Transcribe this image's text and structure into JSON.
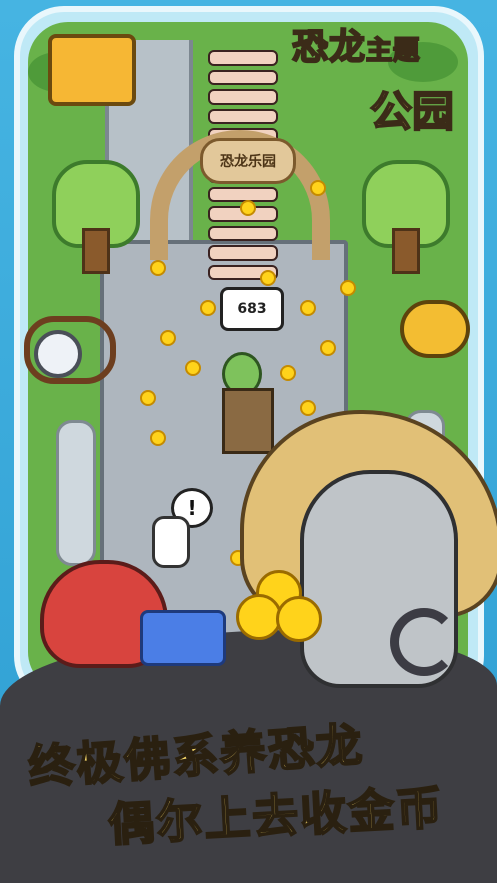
{
  "title": {
    "line1_main": "恐龙",
    "line1_small": "主题",
    "line2": "公园"
  },
  "park_sign": "恐龙乐园",
  "speech_bubble_value": "683",
  "alert_symbol": "!",
  "tagline": {
    "line1": "终极佛系养恐龙",
    "line2": "偶尔上去收金币"
  },
  "colors": {
    "title_fill": "#f6d66f",
    "coin": "#ffd31b",
    "grass": "#69b24a",
    "sky": "#3aa9d8",
    "ground": "#3e3e43"
  },
  "icons": [
    "money-safe-icon",
    "wristwatch-icon",
    "piggy-bank-icon",
    "coin-icon",
    "exclamation-icon"
  ]
}
